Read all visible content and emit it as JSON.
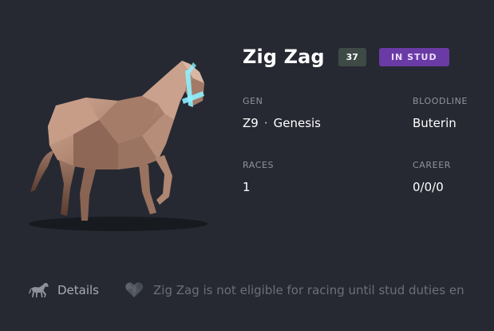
{
  "horse": {
    "name": "Zig Zag",
    "rating": "37",
    "status": "IN STUD"
  },
  "stats": {
    "gen": {
      "label": "GEN",
      "generation": "Z9",
      "separator": "·",
      "breed": "Genesis"
    },
    "bloodline": {
      "label": "BLOODLINE",
      "value": "Buterin"
    },
    "races": {
      "label": "RACES",
      "value": "1"
    },
    "career": {
      "label": "CAREER",
      "value": "0/0/0"
    }
  },
  "footer": {
    "details_label": "Details",
    "notice": "Zig Zag is not eligible for racing until stud duties en"
  },
  "icons": {
    "details": "horse-icon",
    "notice": "heart-icon"
  },
  "colors": {
    "background": "#262932",
    "rating_badge": "#3d4a45",
    "status_badge": "#6a3aa5",
    "bridle_glow": "#8ff0ff",
    "coat": "#b48a74"
  }
}
